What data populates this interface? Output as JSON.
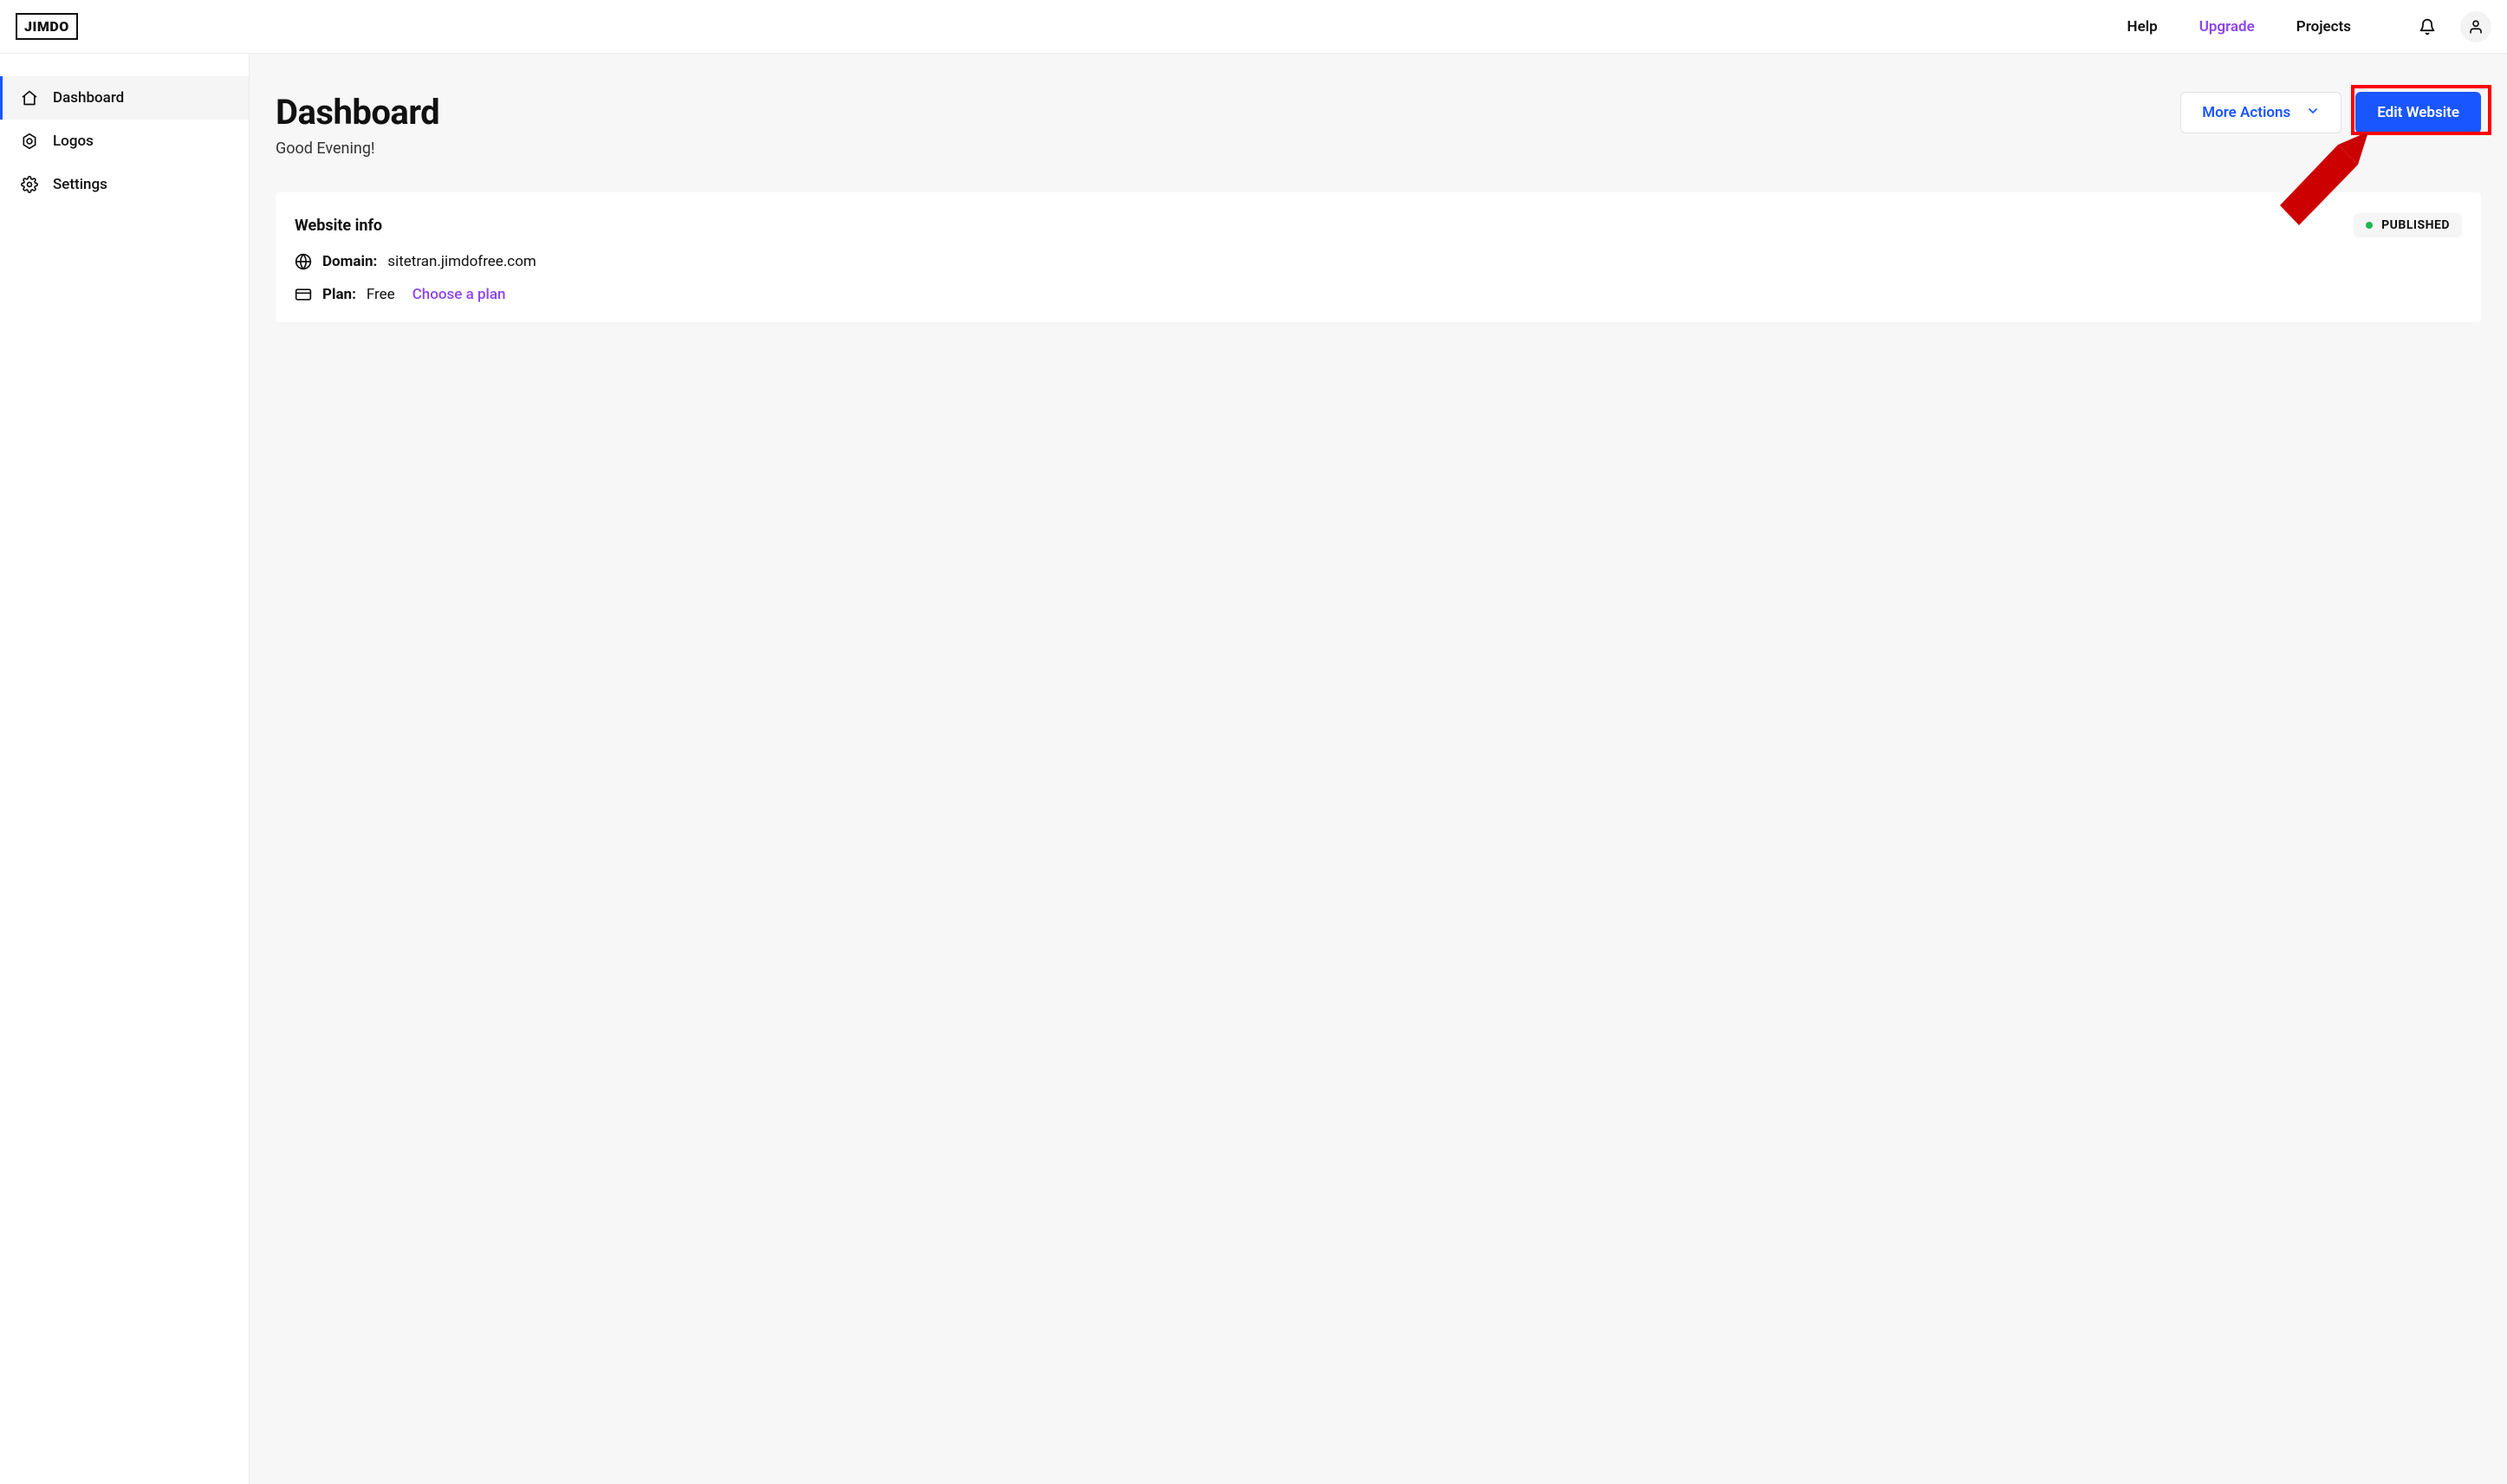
{
  "brand": "JIMDO",
  "topnav": {
    "help": "Help",
    "upgrade": "Upgrade",
    "projects": "Projects"
  },
  "sidebar": {
    "items": [
      {
        "label": "Dashboard",
        "icon": "home",
        "active": true
      },
      {
        "label": "Logos",
        "icon": "logos",
        "active": false
      },
      {
        "label": "Settings",
        "icon": "gear",
        "active": false
      }
    ]
  },
  "page": {
    "title": "Dashboard",
    "greeting": "Good Evening!"
  },
  "actions": {
    "more": "More Actions",
    "edit": "Edit Website"
  },
  "card": {
    "title": "Website info",
    "status": "PUBLISHED",
    "domain_label": "Domain:",
    "domain_value": "sitetran.jimdofree.com",
    "plan_label": "Plan:",
    "plan_value": "Free",
    "choose_plan": "Choose a plan"
  }
}
